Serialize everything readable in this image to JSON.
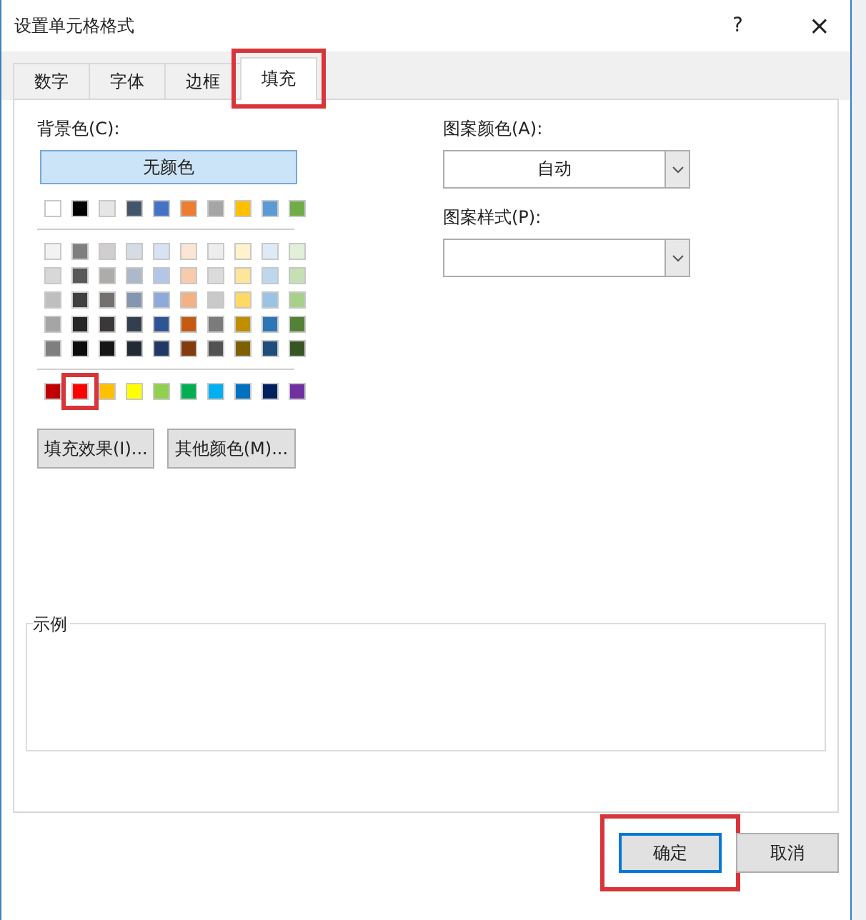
{
  "window": {
    "title": "设置单元格格式",
    "help": "?",
    "close": "×"
  },
  "tabs": [
    {
      "label": "数字",
      "selected": false,
      "highlighted": false
    },
    {
      "label": "字体",
      "selected": false,
      "highlighted": false
    },
    {
      "label": "边框",
      "selected": false,
      "highlighted": false
    },
    {
      "label": "填充",
      "selected": true,
      "highlighted": true
    }
  ],
  "background_color": {
    "label": "背景色(C):",
    "no_color_button": "无颜色",
    "theme_row": [
      {
        "color": "#ffffff",
        "highlighted": false
      },
      {
        "color": "#000000",
        "highlighted": false
      },
      {
        "color": "#e7e6e6",
        "highlighted": false
      },
      {
        "color": "#44546a",
        "highlighted": false
      },
      {
        "color": "#4472c4",
        "highlighted": false
      },
      {
        "color": "#ed7d31",
        "highlighted": false
      },
      {
        "color": "#a5a5a5",
        "highlighted": false
      },
      {
        "color": "#ffc000",
        "highlighted": false
      },
      {
        "color": "#5b9bd5",
        "highlighted": false
      },
      {
        "color": "#70ad47",
        "highlighted": false
      }
    ],
    "shade_rows": [
      [
        {
          "color": "#f2f2f2",
          "highlighted": false
        },
        {
          "color": "#7f7f7f",
          "highlighted": false
        },
        {
          "color": "#d0cece",
          "highlighted": false
        },
        {
          "color": "#d6dce4",
          "highlighted": false
        },
        {
          "color": "#d9e2f3",
          "highlighted": false
        },
        {
          "color": "#fbe5d5",
          "highlighted": false
        },
        {
          "color": "#ededed",
          "highlighted": false
        },
        {
          "color": "#fff2cc",
          "highlighted": false
        },
        {
          "color": "#deebf6",
          "highlighted": false
        },
        {
          "color": "#e2efd9",
          "highlighted": false
        }
      ],
      [
        {
          "color": "#d8d8d8",
          "highlighted": false
        },
        {
          "color": "#595959",
          "highlighted": false
        },
        {
          "color": "#aeabab",
          "highlighted": false
        },
        {
          "color": "#adb9ca",
          "highlighted": false
        },
        {
          "color": "#b4c6e7",
          "highlighted": false
        },
        {
          "color": "#f7cbac",
          "highlighted": false
        },
        {
          "color": "#dbdbdb",
          "highlighted": false
        },
        {
          "color": "#fee599",
          "highlighted": false
        },
        {
          "color": "#bdd7ee",
          "highlighted": false
        },
        {
          "color": "#c5e0b3",
          "highlighted": false
        }
      ],
      [
        {
          "color": "#bfbfbf",
          "highlighted": false
        },
        {
          "color": "#3f3f3f",
          "highlighted": false
        },
        {
          "color": "#757070",
          "highlighted": false
        },
        {
          "color": "#8496b0",
          "highlighted": false
        },
        {
          "color": "#8eaadb",
          "highlighted": false
        },
        {
          "color": "#f4b183",
          "highlighted": false
        },
        {
          "color": "#c9c9c9",
          "highlighted": false
        },
        {
          "color": "#ffd965",
          "highlighted": false
        },
        {
          "color": "#9cc3e5",
          "highlighted": false
        },
        {
          "color": "#a8d08d",
          "highlighted": false
        }
      ],
      [
        {
          "color": "#a5a5a5",
          "highlighted": false
        },
        {
          "color": "#262626",
          "highlighted": false
        },
        {
          "color": "#3a3838",
          "highlighted": false
        },
        {
          "color": "#323f4f",
          "highlighted": false
        },
        {
          "color": "#2f5496",
          "highlighted": false
        },
        {
          "color": "#c55a11",
          "highlighted": false
        },
        {
          "color": "#7b7b7b",
          "highlighted": false
        },
        {
          "color": "#bf8f00",
          "highlighted": false
        },
        {
          "color": "#2e75b5",
          "highlighted": false
        },
        {
          "color": "#538135",
          "highlighted": false
        }
      ],
      [
        {
          "color": "#7f7f7f",
          "highlighted": false
        },
        {
          "color": "#0c0c0c",
          "highlighted": false
        },
        {
          "color": "#171616",
          "highlighted": false
        },
        {
          "color": "#222a35",
          "highlighted": false
        },
        {
          "color": "#1f3864",
          "highlighted": false
        },
        {
          "color": "#833c0b",
          "highlighted": false
        },
        {
          "color": "#525252",
          "highlighted": false
        },
        {
          "color": "#7f6000",
          "highlighted": false
        },
        {
          "color": "#1e4e79",
          "highlighted": false
        },
        {
          "color": "#375623",
          "highlighted": false
        }
      ]
    ],
    "standard_row": [
      {
        "color": "#c00000",
        "highlighted": false
      },
      {
        "color": "#ff0000",
        "highlighted": true
      },
      {
        "color": "#ffc000",
        "highlighted": false
      },
      {
        "color": "#ffff00",
        "highlighted": false
      },
      {
        "color": "#92d050",
        "highlighted": false
      },
      {
        "color": "#00b050",
        "highlighted": false
      },
      {
        "color": "#00b0f0",
        "highlighted": false
      },
      {
        "color": "#0070c0",
        "highlighted": false
      },
      {
        "color": "#002060",
        "highlighted": false
      },
      {
        "color": "#7030a0",
        "highlighted": false
      }
    ],
    "buttons": [
      "填充效果(I)...",
      "其他颜色(M)..."
    ]
  },
  "pattern_color": {
    "label": "图案颜色(A):",
    "value": "自动"
  },
  "pattern_style": {
    "label": "图案样式(P):"
  },
  "sample": {
    "label": "示例"
  },
  "footer_buttons": [
    {
      "label": "确定",
      "default": true,
      "highlighted": true
    },
    {
      "label": "取消",
      "default": false,
      "highlighted": false
    }
  ]
}
